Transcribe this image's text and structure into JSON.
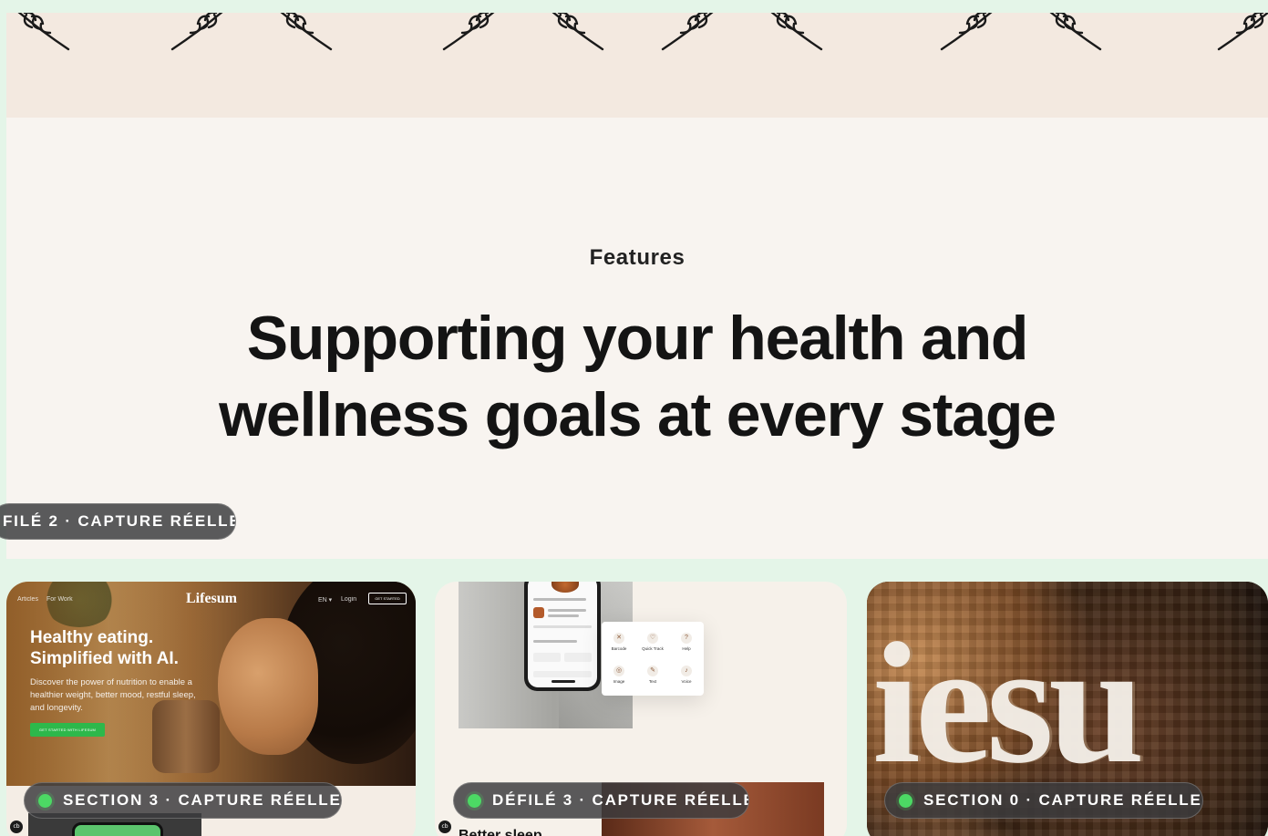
{
  "features": {
    "eyebrow": "Features",
    "headline_line1": "Supporting your health and",
    "headline_line2": "wellness goals at every stage"
  },
  "pills": {
    "top": "FILÉ 2 · CAPTURE RÉELLE",
    "card1": "SECTION 3 · CAPTURE RÉELLE",
    "card2": "DÉFILÉ 3 · CAPTURE RÉELLE",
    "card3": "SECTION 0 · CAPTURE RÉELLE"
  },
  "card1": {
    "nav_left1": "Articles",
    "nav_left2": "For Work",
    "brand": "Lifesum",
    "nav_lang": "EN ▾",
    "nav_login": "Login",
    "nav_cta": "GET STARTED",
    "title_line1": "Healthy eating.",
    "title_line2": "Simplified with AI.",
    "body": "Discover the power of nutrition to enable a healthier weight, better mood, restful sleep, and longevity.",
    "button": "GET STARTED WITH LIFESUM"
  },
  "card2": {
    "panel_items": [
      "Barcode",
      "Quick Track",
      "Help",
      "Image",
      "Text",
      "Voice"
    ],
    "caption": "Better sleep"
  },
  "card3": {
    "zoom_text": "iesu"
  },
  "colors": {
    "band": "#f3e9e0",
    "section": "#f8f4f0",
    "accent_green": "#4cd964",
    "lifesum_green": "#2db84b"
  },
  "icons": {
    "laurel": "laurel-branch-icon",
    "status": "status-dot-icon",
    "badge": "cookie-badge-icon"
  }
}
